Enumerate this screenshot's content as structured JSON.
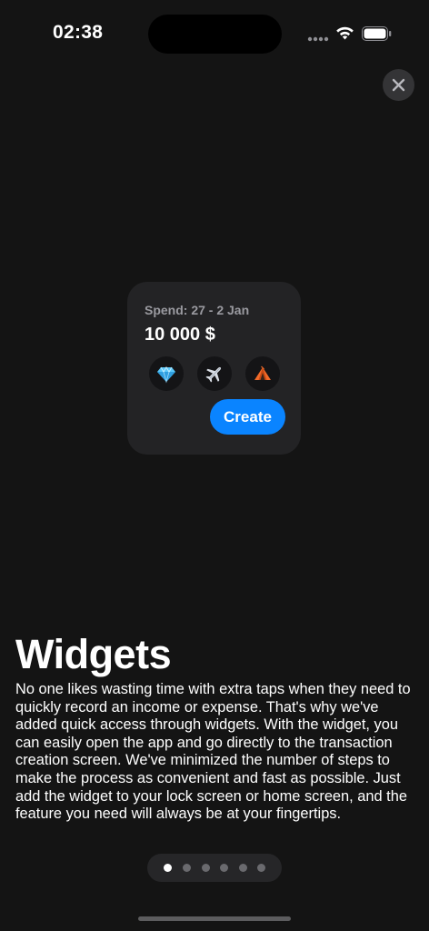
{
  "status_bar": {
    "time": "02:38"
  },
  "close_button": {
    "icon": "close-icon"
  },
  "widget": {
    "period": "Spend: 27 - 2 Jan",
    "amount": "10 000 $",
    "category_icons": [
      "diamond-icon",
      "airplane-icon",
      "tent-icon"
    ],
    "create_label": "Create",
    "accent_color": "#0a84ff"
  },
  "onboarding": {
    "title": "Widgets",
    "description": "No one likes wasting time with extra taps when they need to quickly record an income or expense. That's why we've added quick access through widgets. With the widget, you can easily open the app and go directly to the transaction creation screen. We've minimized the number of steps to make the process as convenient and fast as possible. Just add the widget to your lock screen or home screen, and the feature you need will always be at your fingertips."
  },
  "pagination": {
    "total_pages": 6,
    "current_page": 1
  }
}
